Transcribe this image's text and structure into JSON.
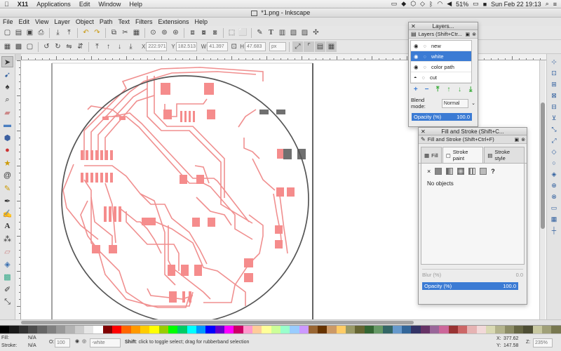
{
  "mac_menu": {
    "apple": "",
    "app": "X11",
    "items": [
      "Applications",
      "Edit",
      "Window",
      "Help"
    ],
    "battery": "51%",
    "clock": "Sun Feb 22  19:13"
  },
  "window": {
    "title": "*1.png - Inkscape"
  },
  "app_menu": [
    "File",
    "Edit",
    "View",
    "Layer",
    "Object",
    "Path",
    "Text",
    "Filters",
    "Extensions",
    "Help"
  ],
  "controls": {
    "x_label": "X",
    "x_value": "222.971",
    "y_label": "Y",
    "y_value": "182.513",
    "w_label": "W",
    "w_value": "41.397",
    "h_label": "H",
    "h_value": "47.683",
    "unit": "px"
  },
  "layers_dialog": {
    "window_title": "Layers...",
    "header": "Layers (Shift+Ctr...",
    "layers": [
      "new",
      "white",
      "color path",
      "cut",
      "trace"
    ],
    "selected": "white",
    "blend_label": "Blend mode:",
    "blend_value": "Normal",
    "opacity_label": "Opacity (%)",
    "opacity_value": "100.0"
  },
  "fill_dialog": {
    "window_title": "Fill and Stroke (Shift+C...",
    "header": "Fill and Stroke (Shift+Ctrl+F)",
    "tabs": [
      "Fill",
      "Stroke paint",
      "Stroke style"
    ],
    "active_tab": "Stroke paint",
    "paint_unknown": "?",
    "paint_none": "×",
    "status": "No objects",
    "blur_label": "Blur (%)",
    "blur_value": "0.0",
    "opacity_label": "Opacity (%)",
    "opacity_value": "100.0"
  },
  "statusbar": {
    "fill_label": "Fill:",
    "fill_value": "N/A",
    "stroke_label": "Stroke:",
    "stroke_value": "N/A",
    "opacity_label": "O:",
    "opacity_value": "100",
    "layer_value": "-white",
    "message_bold": "Shift",
    "message": ": click to toggle select; drag for rubberband selection",
    "x_label": "X:",
    "x_value": "377.62",
    "y_label": "Y:",
    "y_value": "147.58",
    "z_label": "Z:",
    "zoom": "235%"
  },
  "colors": {
    "trace": "#f08f8f",
    "pad": "#f58c8c",
    "selection_blue": "#3b7bd4",
    "circle": "#555555"
  },
  "palette": [
    "#000000",
    "#1a1a1a",
    "#333333",
    "#4d4d4d",
    "#666666",
    "#808080",
    "#999999",
    "#b3b3b3",
    "#cccccc",
    "#e6e6e6",
    "#ffffff",
    "#800000",
    "#ff0000",
    "#ff6600",
    "#ff9900",
    "#ffcc00",
    "#ffff00",
    "#99cc00",
    "#00ff00",
    "#00cc66",
    "#00ffff",
    "#0099ff",
    "#0000ff",
    "#6600cc",
    "#ff00ff",
    "#cc0066",
    "#ff99cc",
    "#ffcc99",
    "#ffff99",
    "#ccff99",
    "#99ffcc",
    "#99ccff",
    "#cc99ff",
    "#996633",
    "#663300",
    "#cc9966",
    "#ffcc66",
    "#999966",
    "#666633",
    "#336633",
    "#669966",
    "#336666",
    "#6699cc",
    "#336699",
    "#333366",
    "#663366",
    "#996699",
    "#cc6699",
    "#993333",
    "#cc6666",
    "#e6b3b3",
    "#f2d9d9",
    "#d9d9b3",
    "#b3b38c",
    "#8c8c66",
    "#666644",
    "#4d4d33",
    "#c8c8a0",
    "#a0a078",
    "#787850"
  ]
}
